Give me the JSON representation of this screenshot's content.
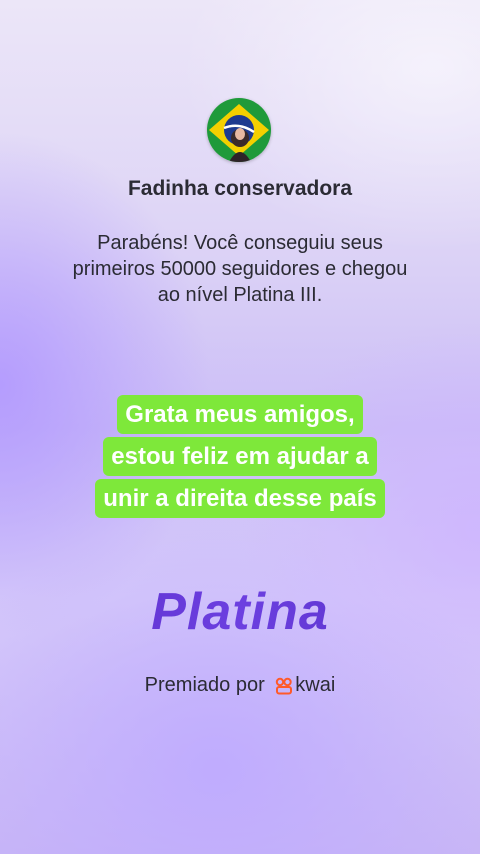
{
  "profile": {
    "username": "Fadinha conservadora",
    "avatar_icon": "brazil-flag-avatar"
  },
  "achievement": {
    "message": "Parabéns! Você conseguiu seus primeiros 50000 seguidores e chegou ao nível Platina III."
  },
  "caption": {
    "text": "Grata meus amigos, estou feliz em ajudar a unir a direita desse país",
    "background_color": "#7ee83a"
  },
  "tier": {
    "label": "Platina",
    "color": "#5a2fd0"
  },
  "sponsor": {
    "prefix": "Premiado por",
    "brand": "kwai",
    "logo_icon": "kwai-logo-icon",
    "logo_color": "#ff5a2a"
  }
}
